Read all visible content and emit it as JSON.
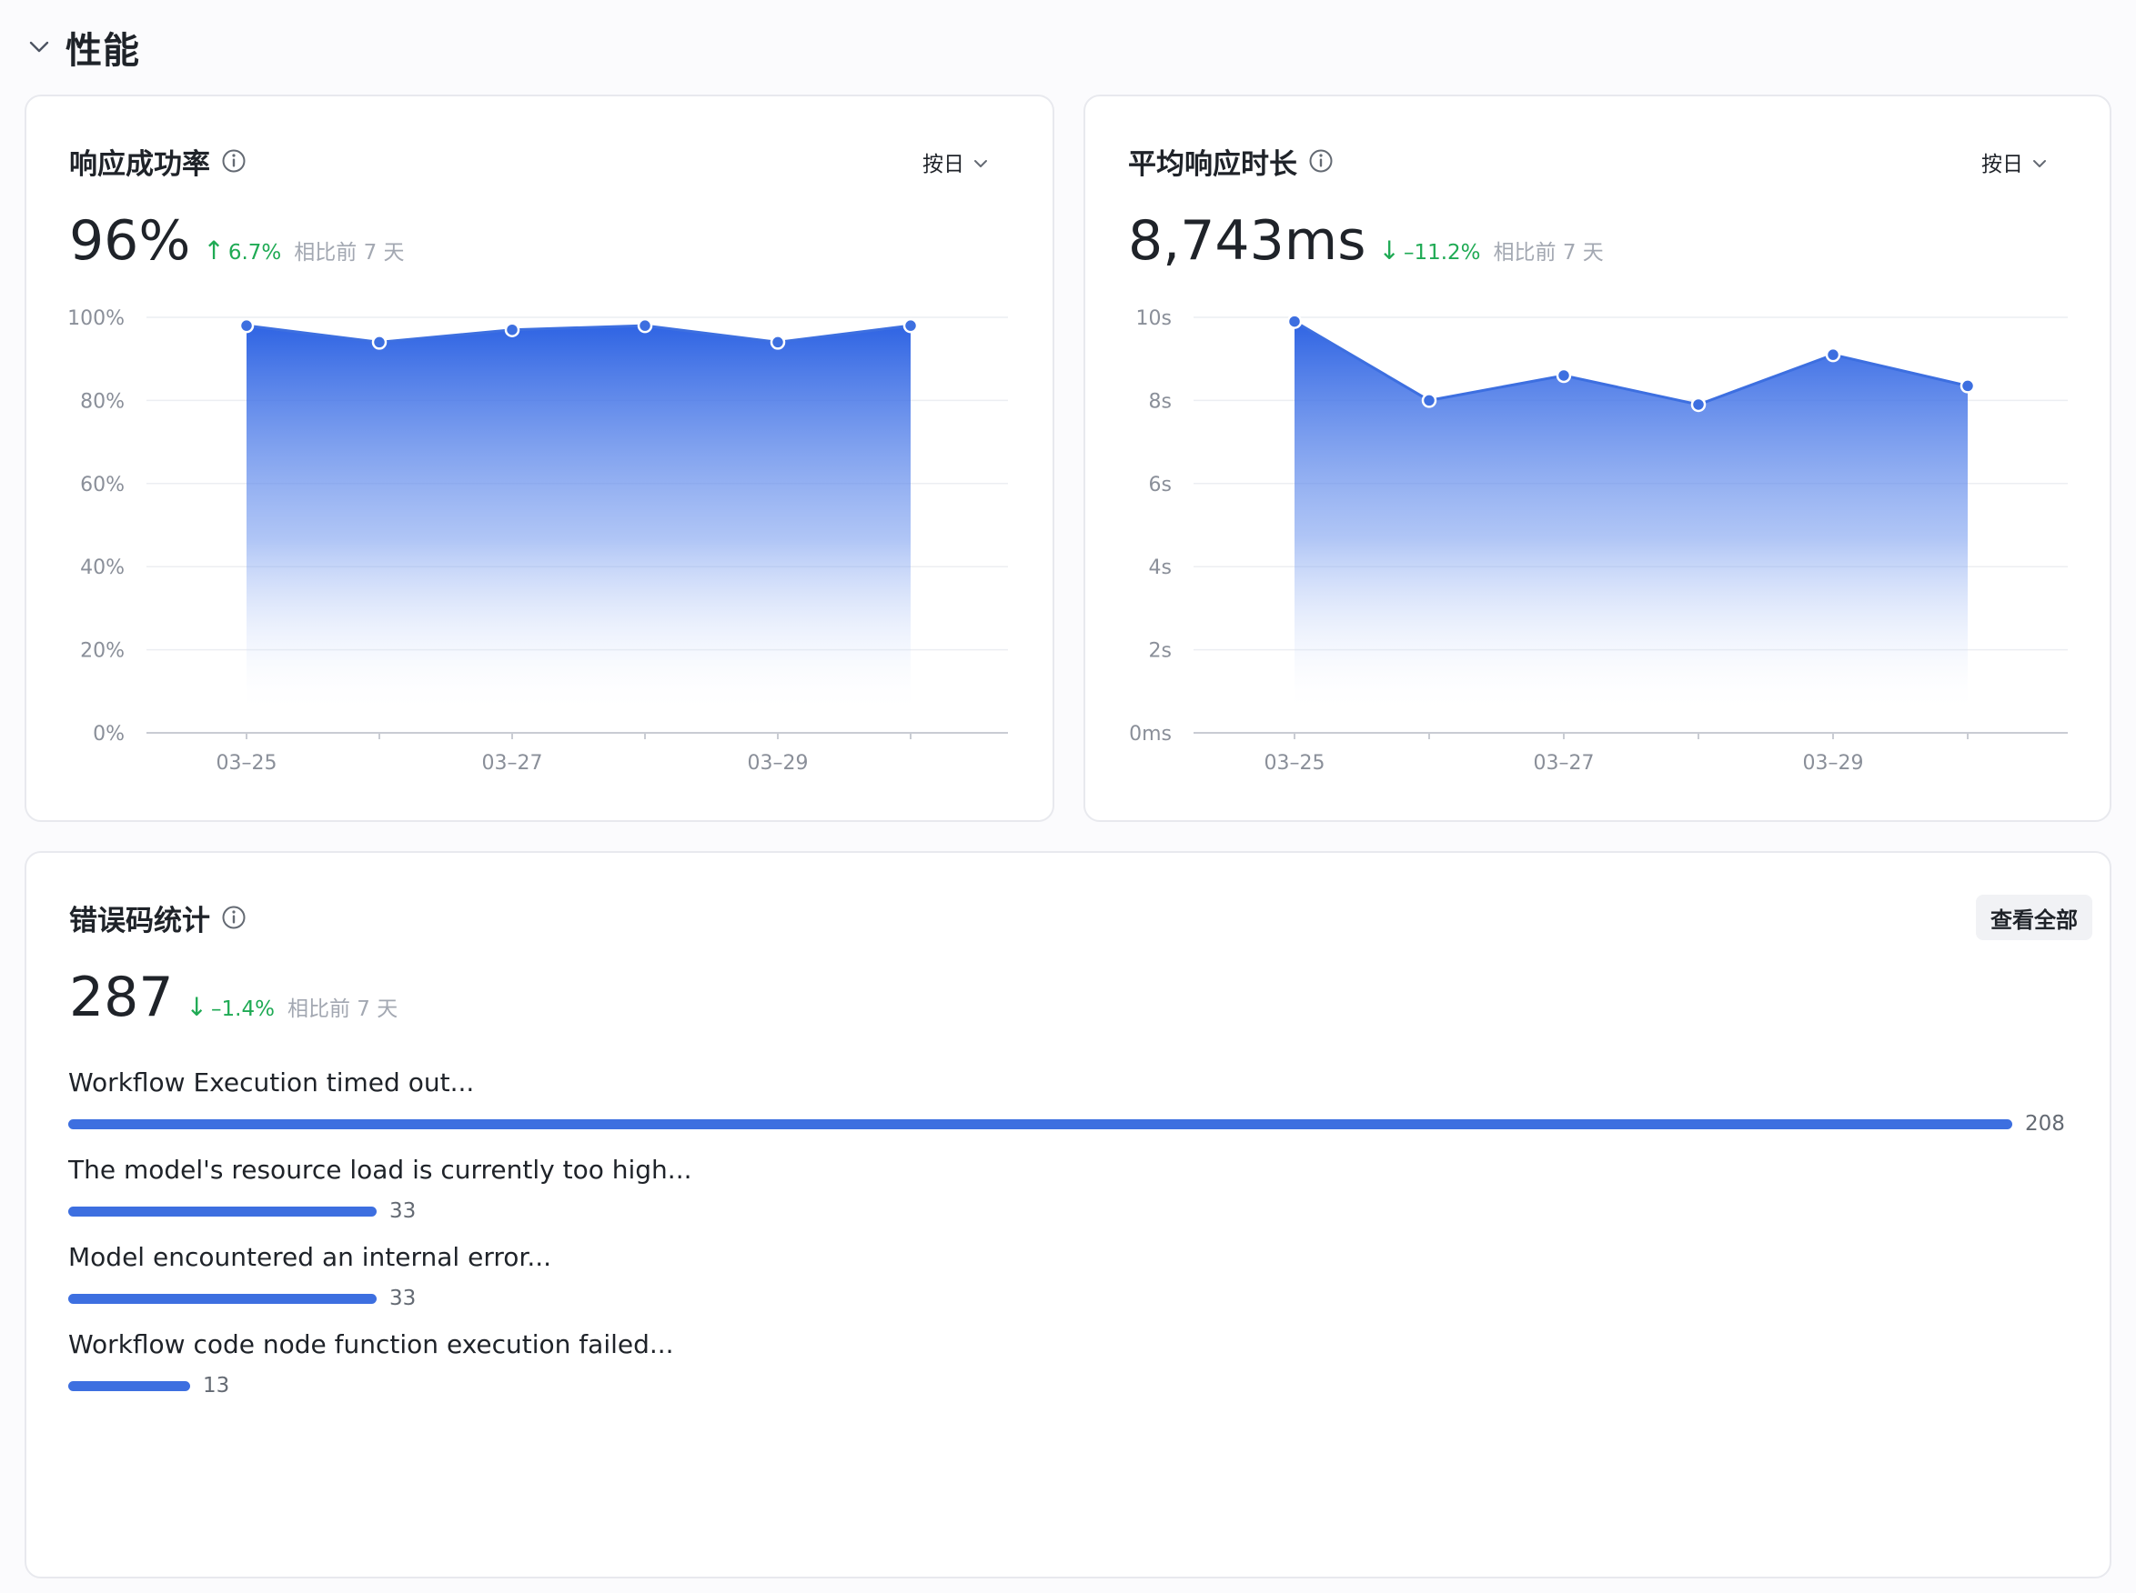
{
  "section": {
    "title": "性能",
    "icon": "chevron-down-icon"
  },
  "colors": {
    "accent": "#3d6fe0",
    "positive": "#1faa54",
    "muted": "#a3a8b2",
    "grid": "#eceef2"
  },
  "success_card": {
    "title": "响应成功率",
    "period_label": "按日",
    "metric": "96%",
    "delta_arrow": "↑",
    "delta": "6.7%",
    "delta_note": "相比前 7 天"
  },
  "latency_card": {
    "title": "平均响应时长",
    "period_label": "按日",
    "metric": "8,743ms",
    "delta_arrow": "↓",
    "delta": "–11.2%",
    "delta_note": "相比前 7 天"
  },
  "errors_card": {
    "title": "错误码统计",
    "view_all_label": "查看全部",
    "metric": "287",
    "delta_arrow": "↓",
    "delta": "–1.4%",
    "delta_note": "相比前 7 天",
    "max": 208,
    "items": [
      {
        "label": "Workflow Execution timed out...",
        "count": 208,
        "count_label": "208"
      },
      {
        "label": "The model's resource load is currently too high...",
        "count": 33,
        "count_label": "33"
      },
      {
        "label": "Model encountered an internal error...",
        "count": 33,
        "count_label": "33"
      },
      {
        "label": "Workflow code node function execution failed...",
        "count": 13,
        "count_label": "13"
      }
    ]
  },
  "chart_data": [
    {
      "type": "area",
      "x": [
        "03–25",
        "03–26",
        "03–27",
        "03–28",
        "03–29",
        "03–30"
      ],
      "x_tick_labels": [
        "03–25",
        "03–27",
        "03–29"
      ],
      "values": [
        98,
        94,
        97,
        98,
        94,
        98
      ],
      "ylim": [
        0,
        100
      ],
      "y_tick_labels": [
        "0%",
        "20%",
        "40%",
        "60%",
        "80%",
        "100%"
      ],
      "grid": true
    },
    {
      "type": "area",
      "x": [
        "03–25",
        "03–26",
        "03–27",
        "03–28",
        "03–29",
        "03–30"
      ],
      "x_tick_labels": [
        "03–25",
        "03–27",
        "03–29"
      ],
      "values": [
        9.9,
        8.0,
        8.6,
        7.9,
        9.1,
        8.35
      ],
      "ylim": [
        0,
        10
      ],
      "y_tick_labels": [
        "0ms",
        "2s",
        "4s",
        "6s",
        "8s",
        "10s"
      ],
      "grid": true
    }
  ]
}
